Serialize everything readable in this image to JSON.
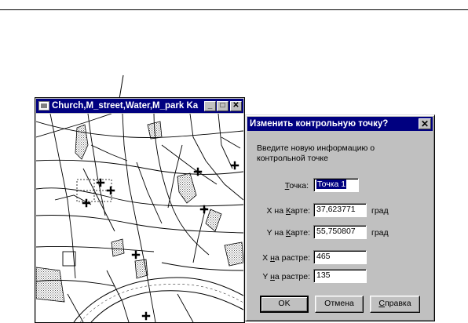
{
  "map_window": {
    "title": "Church,M_street,Water,M_park Ka",
    "icon": "map-window-icon",
    "controls": {
      "minimize": "_",
      "maximize": "□",
      "close": "✕"
    }
  },
  "dialog": {
    "title": "Изменить контрольную точку?",
    "close_glyph": "✕",
    "prompt": "Введите новую информацию о контрольной точке",
    "point": {
      "label_pre": "",
      "label_key": "Т",
      "label_post": "очка:",
      "value": "Точка 1"
    },
    "x_map": {
      "label_pre": "X на ",
      "label_key": "К",
      "label_post": "арте:",
      "value": "37,623771",
      "unit": "град"
    },
    "y_map": {
      "label_pre": "Y на ",
      "label_key": "К",
      "label_post": "арте:",
      "value": "55,750807",
      "unit": "град"
    },
    "x_raster": {
      "label_pre": "X ",
      "label_key": "н",
      "label_post": "а растре:",
      "value": "465"
    },
    "y_raster": {
      "label_pre": "Y ",
      "label_key": "н",
      "label_post": "а растре:",
      "value": "135"
    },
    "buttons": {
      "ok": "OK",
      "cancel": "Отмена",
      "help_key": "С",
      "help_rest": "правка"
    }
  }
}
